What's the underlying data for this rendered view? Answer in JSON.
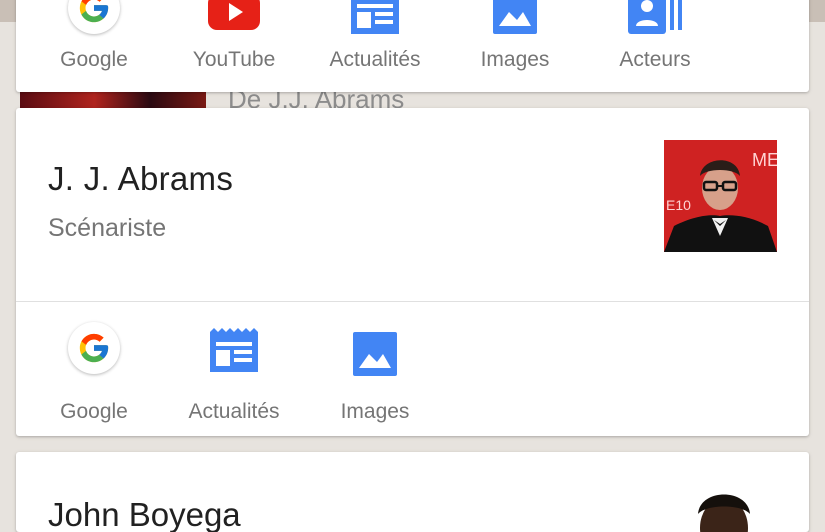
{
  "top_card": {
    "actions": [
      {
        "label": "Google",
        "icon": "google-icon"
      },
      {
        "label": "YouTube",
        "icon": "youtube-icon"
      },
      {
        "label": "Actualités",
        "icon": "news-icon"
      },
      {
        "label": "Images",
        "icon": "image-icon"
      },
      {
        "label": "Acteurs",
        "icon": "actors-icon"
      }
    ]
  },
  "behind": {
    "text": "De J.J. Abrams"
  },
  "person_card": {
    "name": "J. J. Abrams",
    "role": "Scénariste",
    "actions": [
      {
        "label": "Google",
        "icon": "google-icon"
      },
      {
        "label": "Actualités",
        "icon": "news-icon"
      },
      {
        "label": "Images",
        "icon": "image-icon"
      }
    ]
  },
  "next_card": {
    "name": "John Boyega"
  },
  "colors": {
    "accent_blue": "#4285f4",
    "youtube_red": "#e62117"
  }
}
